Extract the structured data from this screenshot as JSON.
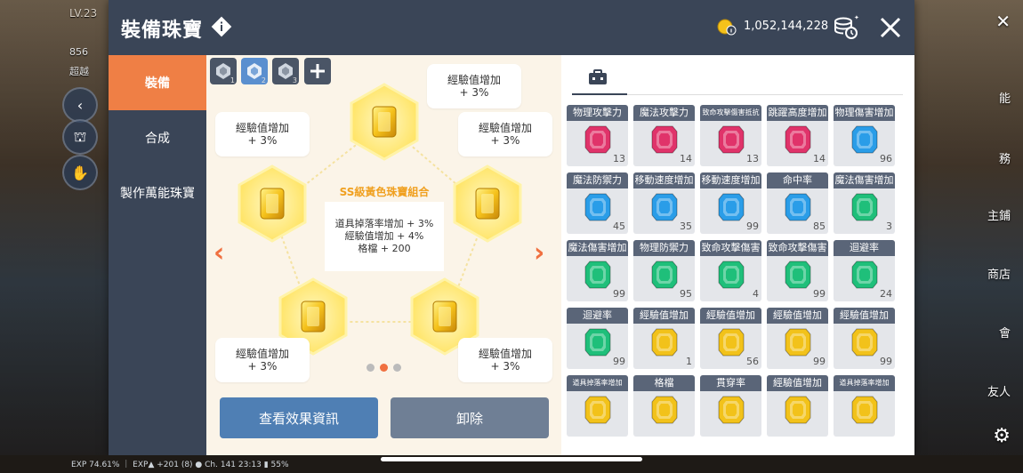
{
  "header": {
    "title": "裝備珠寶",
    "currency_value": "1,052,144,228"
  },
  "hud": {
    "level": "LV.23",
    "line2": "856",
    "line3": "超越",
    "exp_bar": "EXP 74.61% ｜ EXP▲ +201 (8) ● Ch. 141  23:13  ▮ 55%",
    "right_labels": [
      "能",
      "務",
      "主鋪",
      "商店",
      "會",
      "友人"
    ]
  },
  "tabs": [
    {
      "label": "裝備",
      "active": true
    },
    {
      "label": "合成",
      "active": false
    },
    {
      "label": "製作萬能珠寶",
      "active": false
    }
  ],
  "presets": [
    {
      "num": "1",
      "active": false
    },
    {
      "num": "2",
      "active": true
    },
    {
      "num": "3",
      "active": false
    }
  ],
  "bubbles": [
    {
      "title": "經驗值增加",
      "value": "+ 3%"
    },
    {
      "title": "經驗值增加",
      "value": "+ 3%"
    },
    {
      "title": "經驗值增加",
      "value": "+ 3%"
    },
    {
      "title": "經驗值增加",
      "value": "+ 3%"
    },
    {
      "title": "經驗值增加",
      "value": "+ 3%"
    }
  ],
  "combo": {
    "title": "SS級黃色珠寶組合",
    "lines": [
      "道具掉落率增加 + 3%",
      "經驗值增加 + 4%",
      "格檔 + 200"
    ]
  },
  "pagination": {
    "total": 3,
    "current": 2
  },
  "buttons": {
    "view_effects": "查看效果資訊",
    "unequip": "卸除"
  },
  "colors": {
    "header": "#3a4557",
    "active_tab": "#ef7f45",
    "button_blue": "#4f7fb4",
    "button_gray": "#6f7f95",
    "red_gem": "#e0336a",
    "blue_gem": "#2a9de8",
    "green_gem": "#1fbf7a",
    "yellow_gem": "#f2c21a"
  },
  "inventory": [
    {
      "name": "物理攻擊力",
      "count": "13",
      "color": "red"
    },
    {
      "name": "魔法攻擊力",
      "count": "14",
      "color": "red"
    },
    {
      "name": "致命攻擊傷害抵抗",
      "count": "13",
      "color": "red",
      "small": true
    },
    {
      "name": "跳躍高度增加",
      "count": "14",
      "color": "red"
    },
    {
      "name": "物理傷害增加",
      "count": "96",
      "color": "blue"
    },
    {
      "name": "魔法防禦力",
      "count": "45",
      "color": "blue"
    },
    {
      "name": "移動速度增加",
      "count": "35",
      "color": "blue"
    },
    {
      "name": "移動速度增加",
      "count": "99",
      "color": "blue"
    },
    {
      "name": "命中率",
      "count": "85",
      "color": "blue"
    },
    {
      "name": "魔法傷害增加",
      "count": "3",
      "color": "green"
    },
    {
      "name": "魔法傷害增加",
      "count": "99",
      "color": "green"
    },
    {
      "name": "物理防禦力",
      "count": "95",
      "color": "green"
    },
    {
      "name": "致命攻擊傷害",
      "count": "4",
      "color": "green"
    },
    {
      "name": "致命攻擊傷害",
      "count": "99",
      "color": "green"
    },
    {
      "name": "迴避率",
      "count": "24",
      "color": "green"
    },
    {
      "name": "迴避率",
      "count": "99",
      "color": "green"
    },
    {
      "name": "經驗值增加",
      "count": "1",
      "color": "yellow"
    },
    {
      "name": "經驗值增加",
      "count": "56",
      "color": "yellow"
    },
    {
      "name": "經驗值增加",
      "count": "99",
      "color": "yellow"
    },
    {
      "name": "經驗值增加",
      "count": "99",
      "color": "yellow"
    },
    {
      "name": "道具掉落率增加",
      "count": "",
      "color": "yellow",
      "small": true
    },
    {
      "name": "格檔",
      "count": "",
      "color": "yellow"
    },
    {
      "name": "貫穿率",
      "count": "",
      "color": "yellow"
    },
    {
      "name": "經驗值增加",
      "count": "",
      "color": "yellow"
    },
    {
      "name": "道具掉落率增加",
      "count": "",
      "color": "yellow",
      "small": true
    }
  ]
}
